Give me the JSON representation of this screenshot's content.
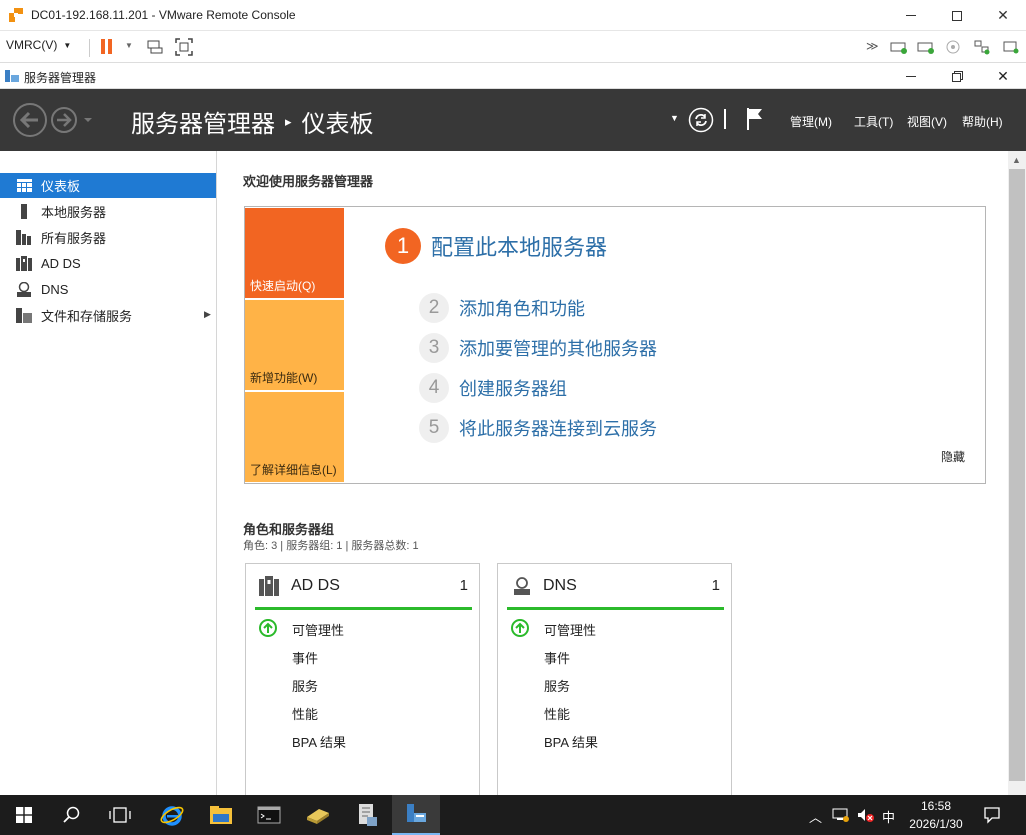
{
  "vmrc": {
    "title": "DC01-192.168.11.201 - VMware Remote Console",
    "menu_label": "VMRC(V)"
  },
  "sm": {
    "window_title": "服务器管理器",
    "breadcrumb_app": "服务器管理器",
    "breadcrumb_sep": "▸",
    "breadcrumb_page": "仪表板",
    "menu": [
      "管理(M)",
      "工具(T)",
      "视图(V)",
      "帮助(H)"
    ]
  },
  "nav": {
    "items": [
      {
        "label": "仪表板",
        "icon": "dashboard-icon",
        "selected": true
      },
      {
        "label": "本地服务器",
        "icon": "local-server-icon"
      },
      {
        "label": "所有服务器",
        "icon": "all-servers-icon"
      },
      {
        "label": "AD DS",
        "icon": "ad-ds-icon"
      },
      {
        "label": "DNS",
        "icon": "dns-icon"
      },
      {
        "label": "文件和存储服务",
        "icon": "file-storage-icon"
      }
    ],
    "expand_arrow": "▶"
  },
  "welcome": {
    "heading": "欢迎使用服务器管理器",
    "tiles": [
      "快速启动(Q)",
      "新增功能(W)",
      "了解详细信息(L)"
    ],
    "primary_step": {
      "num": "1",
      "label": "配置此本地服务器"
    },
    "steps": [
      {
        "num": "2",
        "label": "添加角色和功能"
      },
      {
        "num": "3",
        "label": "添加要管理的其他服务器"
      },
      {
        "num": "4",
        "label": "创建服务器组"
      },
      {
        "num": "5",
        "label": "将此服务器连接到云服务"
      }
    ],
    "hide": "隐藏"
  },
  "roles": {
    "heading": "角色和服务器组",
    "summary": "角色: 3 | 服务器组: 1 | 服务器总数: 1",
    "cards": [
      {
        "name": "AD DS",
        "count": "1",
        "rows": [
          "可管理性",
          "事件",
          "服务",
          "性能",
          "BPA 结果"
        ]
      },
      {
        "name": "DNS",
        "count": "1",
        "rows": [
          "可管理性",
          "事件",
          "服务",
          "性能",
          "BPA 结果"
        ]
      }
    ]
  },
  "taskbar": {
    "time": "16:58",
    "date": "2026/1/30",
    "ime": "中"
  },
  "colors": {
    "accent_orange": "#f26522",
    "tile_yellow": "#ffb347",
    "header_dark": "#383838",
    "nav_selected": "#1f7ad3",
    "status_green": "#2bba2b",
    "link_blue": "#2d6fa8"
  }
}
